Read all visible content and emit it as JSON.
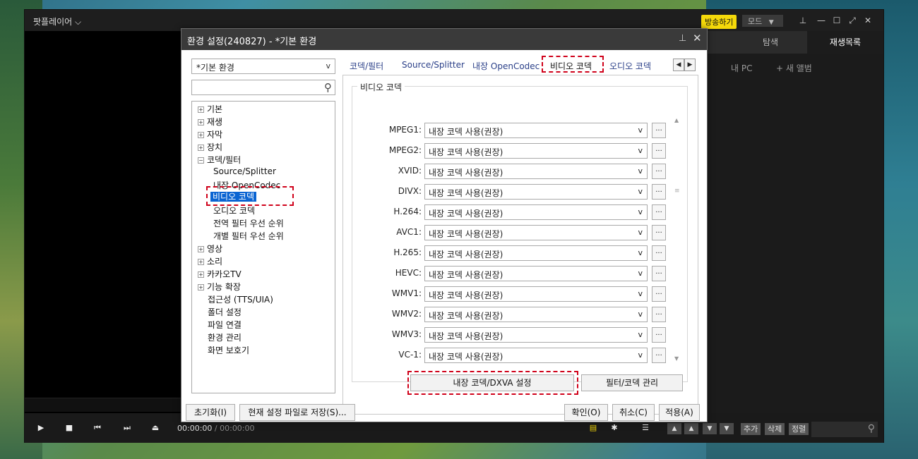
{
  "player": {
    "app_name": "팟플레이어 ⌵",
    "broadcast_label": "방송하기",
    "mode_label": "모드",
    "tabs": [
      "탐색",
      "재생목록"
    ],
    "sub_tabs": [
      "내 PC",
      "+ 새 앨범"
    ],
    "time_current": "00:00:00",
    "time_sep": " / ",
    "time_total": "00:00:00",
    "playlist_buttons": [
      "추가",
      "삭제",
      "정렬"
    ]
  },
  "dialog": {
    "title": "환경 설정(240827) - *기본 환경",
    "profile": "*기본 환경",
    "tree": [
      {
        "label": "기본",
        "expander": "+"
      },
      {
        "label": "재생",
        "expander": "+"
      },
      {
        "label": "자막",
        "expander": "+"
      },
      {
        "label": "장치",
        "expander": "+"
      },
      {
        "label": "코덱/필터",
        "expander": "−"
      },
      {
        "label": "Source/Splitter",
        "child": true
      },
      {
        "label": "내장 OpenCodec",
        "child": true
      },
      {
        "label": "비디오 코덱",
        "child": true,
        "selected": true
      },
      {
        "label": "오디오 코덱",
        "child": true
      },
      {
        "label": "전역 필터 우선 순위",
        "child": true
      },
      {
        "label": "개별 필터 우선 순위",
        "child": true
      },
      {
        "label": "영상",
        "expander": "+"
      },
      {
        "label": "소리",
        "expander": "+"
      },
      {
        "label": "카카오TV",
        "expander": "+"
      },
      {
        "label": "기능 확장",
        "expander": "+"
      },
      {
        "label": "접근성 (TTS/UIA)"
      },
      {
        "label": "폴더 설정"
      },
      {
        "label": "파일 연결"
      },
      {
        "label": "환경 관리"
      },
      {
        "label": "화면 보호기"
      }
    ],
    "tabs": [
      "코덱/필터",
      "Source/Splitter",
      "내장 OpenCodec",
      "비디오 코덱",
      "오디오 코덱"
    ],
    "active_tab": "비디오 코덱",
    "group_label": "비디오 코덱",
    "codec_rows": [
      {
        "label": "MPEG1:",
        "value": "내장 코덱 사용(권장)"
      },
      {
        "label": "MPEG2:",
        "value": "내장 코덱 사용(권장)"
      },
      {
        "label": "XVID:",
        "value": "내장 코덱 사용(권장)"
      },
      {
        "label": "DIVX:",
        "value": "내장 코덱 사용(권장)"
      },
      {
        "label": "H.264:",
        "value": "내장 코덱 사용(권장)"
      },
      {
        "label": "AVC1:",
        "value": "내장 코덱 사용(권장)"
      },
      {
        "label": "H.265:",
        "value": "내장 코덱 사용(권장)"
      },
      {
        "label": "HEVC:",
        "value": "내장 코덱 사용(권장)"
      },
      {
        "label": "WMV1:",
        "value": "내장 코덱 사용(권장)"
      },
      {
        "label": "WMV2:",
        "value": "내장 코덱 사용(권장)"
      },
      {
        "label": "WMV3:",
        "value": "내장 코덱 사용(권장)"
      },
      {
        "label": "VC-1:",
        "value": "내장 코덱 사용(권장)"
      }
    ],
    "more_label": "...",
    "dxva_button": "내장 코덱/DXVA 설정",
    "filter_button": "필터/코덱 관리",
    "footer": {
      "reset": "초기화(I)",
      "save_to_file": "현재 설정 파일로 저장(S)...",
      "ok": "확인(O)",
      "cancel": "취소(C)",
      "apply": "적용(A)"
    }
  },
  "colors": {
    "highlight": "#0a64d2",
    "annotation": "#d0021b",
    "broadcast": "#f5d90a"
  }
}
